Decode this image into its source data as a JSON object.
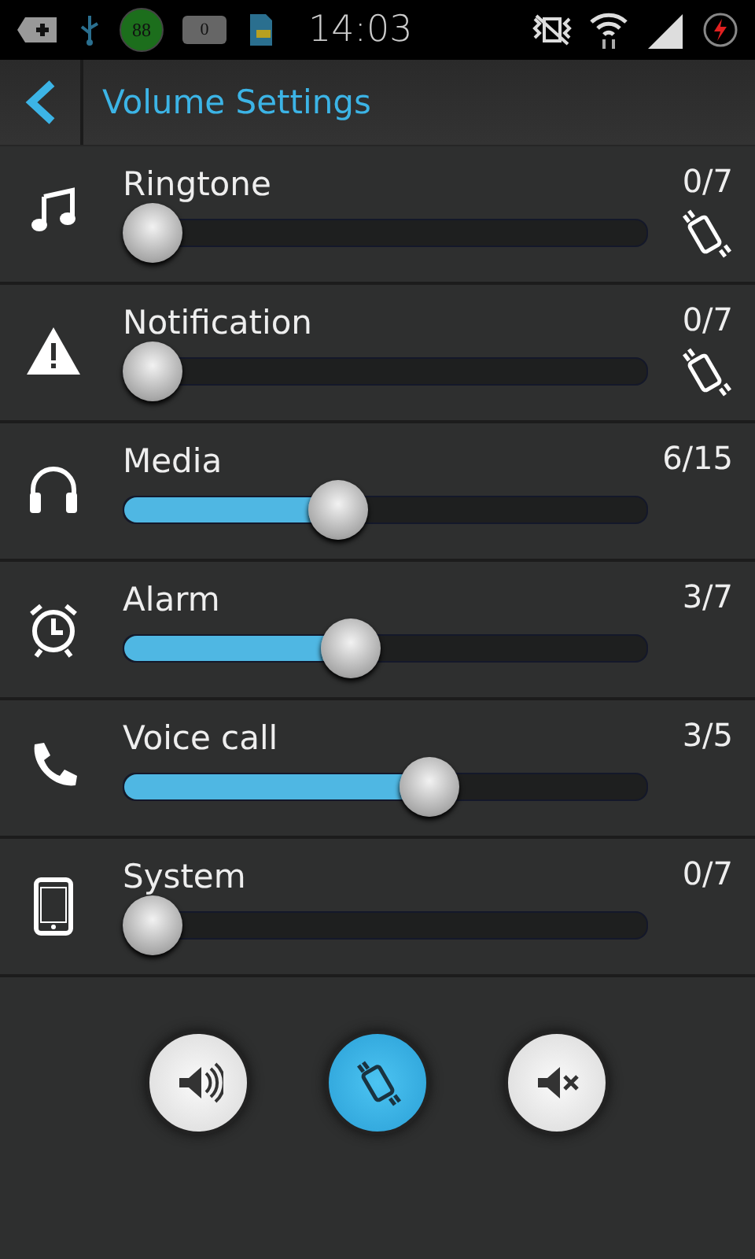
{
  "status_bar": {
    "temperature": "88",
    "battery_badge": "0",
    "time": "14:03"
  },
  "window": {
    "title": "Volume Settings"
  },
  "channels": [
    {
      "kind": "music",
      "name": "Ringtone",
      "reading": "0/7",
      "level": 0,
      "vibrate": true
    },
    {
      "kind": "warning",
      "name": "Notification",
      "reading": "0/7",
      "level": 0,
      "vibrate": true
    },
    {
      "kind": "headphones",
      "name": "Media",
      "reading": "6/15",
      "level": 0.4,
      "vibrate": false
    },
    {
      "kind": "alarm",
      "name": "Alarm",
      "reading": "3/7",
      "level": 0.43,
      "vibrate": false
    },
    {
      "kind": "phone",
      "name": "Voice call",
      "reading": "3/5",
      "level": 0.6,
      "vibrate": false
    },
    {
      "kind": "device",
      "name": "System",
      "reading": "0/7",
      "level": 0,
      "vibrate": false
    }
  ],
  "modes": [
    {
      "kind": "sound",
      "selected": false
    },
    {
      "kind": "vibrate",
      "selected": true
    },
    {
      "kind": "mute",
      "selected": false
    }
  ]
}
